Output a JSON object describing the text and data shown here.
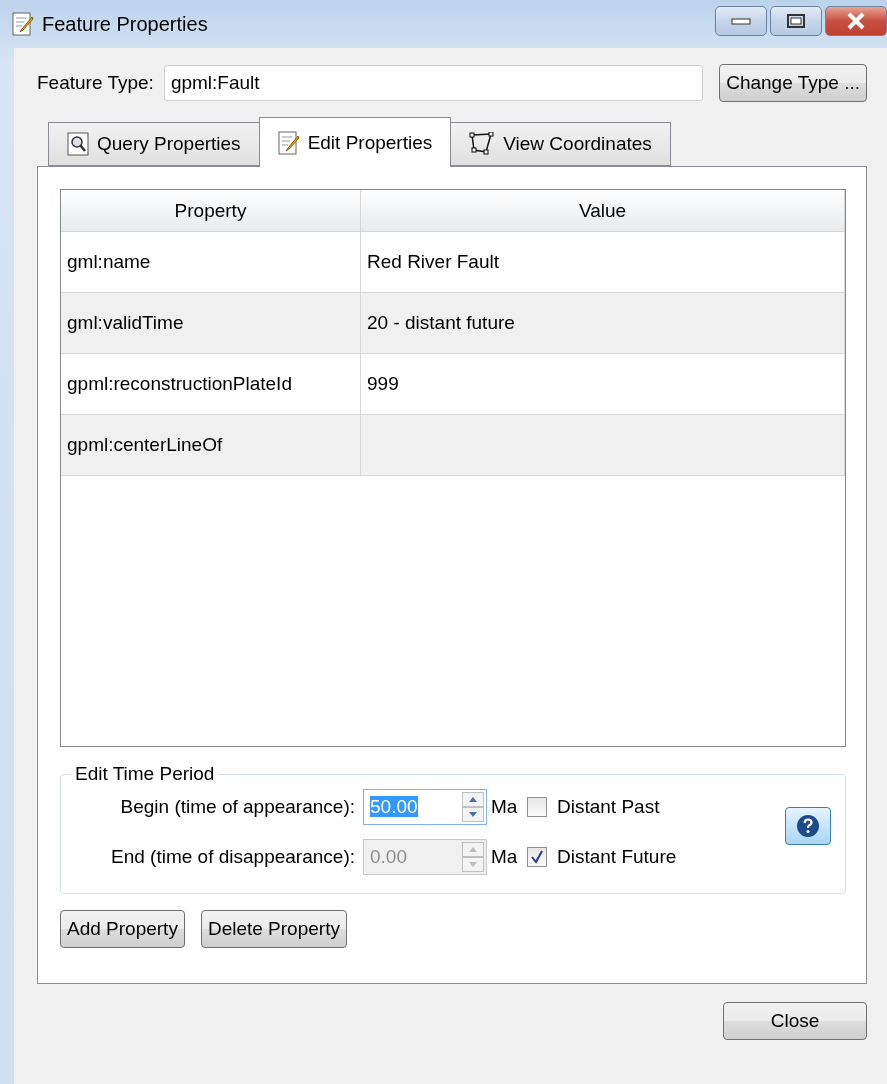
{
  "window": {
    "title": "Feature Properties"
  },
  "feature_type": {
    "label": "Feature Type:",
    "value": "gpml:Fault"
  },
  "change_type_button": "Change Type ...",
  "tabs": [
    {
      "label": "Query Properties",
      "kind": "query",
      "selected": false
    },
    {
      "label": "Edit Properties",
      "kind": "edit",
      "selected": true
    },
    {
      "label": "View Coordinates",
      "kind": "coordinates",
      "selected": false
    }
  ],
  "table": {
    "columns": [
      "Property",
      "Value"
    ],
    "rows": [
      {
        "property": "gml:name",
        "value": "Red River Fault"
      },
      {
        "property": "gml:validTime",
        "value": "20 - distant future"
      },
      {
        "property": "gpml:reconstructionPlateId",
        "value": "999"
      },
      {
        "property": "gpml:centerLineOf"
      }
    ]
  },
  "time_period": {
    "title": "Edit Time Period",
    "rows": [
      {
        "label": "Begin (time of appearance):",
        "value": "50.00",
        "value_selected": true,
        "disabled": false,
        "unit": "Ma",
        "checkbox_label": "Distant Past",
        "checked": false
      },
      {
        "label": "End (time of disappearance):",
        "value": "0.00",
        "value_selected": false,
        "disabled": true,
        "unit": "Ma",
        "checkbox_label": "Distant Future",
        "checked": true
      }
    ]
  },
  "property_buttons": [
    "Add Property",
    "Delete Property"
  ],
  "close_button": "Close"
}
